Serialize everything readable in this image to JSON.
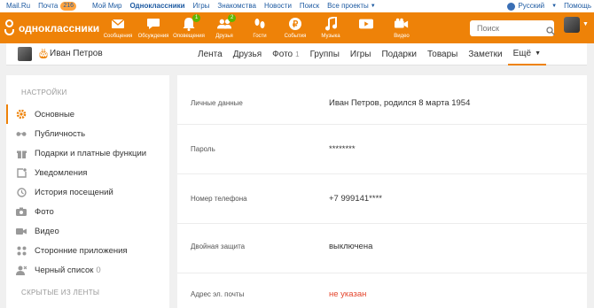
{
  "portal_bar": {
    "links": [
      {
        "label": "Mail.Ru"
      },
      {
        "label": "Почта",
        "badge": "216"
      },
      {
        "label": "Мой Мир"
      },
      {
        "label": "Одноклассники",
        "current": true
      },
      {
        "label": "Игры"
      },
      {
        "label": "Знакомства"
      },
      {
        "label": "Новости"
      },
      {
        "label": "Поиск"
      },
      {
        "label": "Все проекты"
      }
    ],
    "language": "Русский",
    "help": "Помощь"
  },
  "toolbar": {
    "logo_text": "одноклассники",
    "nav": [
      {
        "label": "Сообщения",
        "icon": "envelope-icon",
        "count": ""
      },
      {
        "label": "Обсуждения",
        "icon": "chat-bubble-icon",
        "count": ""
      },
      {
        "label": "Оповещения",
        "icon": "bell-icon",
        "count": "1"
      },
      {
        "label": "Друзья",
        "icon": "friends-icon",
        "count": "2"
      },
      {
        "label": "Гости",
        "icon": "footprints-icon",
        "count": ""
      },
      {
        "label": "События",
        "icon": "ruble-icon",
        "count": ""
      },
      {
        "label": "Музыка",
        "icon": "music-note-icon",
        "count": ""
      },
      {
        "label": "",
        "icon": "video-play-icon",
        "count": ""
      },
      {
        "label": "Видео",
        "icon": "video-camera-icon",
        "count": ""
      }
    ],
    "search_placeholder": "Поиск"
  },
  "profile": {
    "name": "Иван Петров",
    "tabs": [
      {
        "label": "Лента"
      },
      {
        "label": "Друзья"
      },
      {
        "label": "Фото",
        "count": "1"
      },
      {
        "label": "Группы"
      },
      {
        "label": "Игры"
      },
      {
        "label": "Подарки"
      },
      {
        "label": "Товары"
      },
      {
        "label": "Заметки"
      },
      {
        "label": "Ещё",
        "active": true
      }
    ]
  },
  "sidebar": {
    "title": "Настройки",
    "items": [
      {
        "label": "Основные",
        "icon": "gear-icon",
        "active": true
      },
      {
        "label": "Публичность",
        "icon": "glasses-icon"
      },
      {
        "label": "Подарки и платные функции",
        "icon": "gift-icon"
      },
      {
        "label": "Уведомления",
        "icon": "notification-icon"
      },
      {
        "label": "История посещений",
        "icon": "clock-icon"
      },
      {
        "label": "Фото",
        "icon": "camera-icon"
      },
      {
        "label": "Видео",
        "icon": "video-camera-icon"
      },
      {
        "label": "Сторонние приложения",
        "icon": "apps-icon"
      },
      {
        "label": "Черный список",
        "icon": "blacklist-icon",
        "count": "0"
      }
    ],
    "section2": "СКРЫТЫЕ ИЗ ЛЕНТЫ"
  },
  "settings": [
    {
      "label": "Личные данные",
      "value": "Иван Петров, родился 8 марта 1954"
    },
    {
      "label": "Пароль",
      "value": "********"
    },
    {
      "label": "Номер телефона",
      "value": "+7 999141****"
    },
    {
      "label": "Двойная защита",
      "value": "выключена"
    },
    {
      "label": "Адрес эл. почты",
      "value": "не указан",
      "warning": true
    }
  ],
  "colors": {
    "brand": "#ee8208",
    "link": "#1d5aa1",
    "warning": "#e4442b",
    "badge_green": "#5fb600"
  }
}
